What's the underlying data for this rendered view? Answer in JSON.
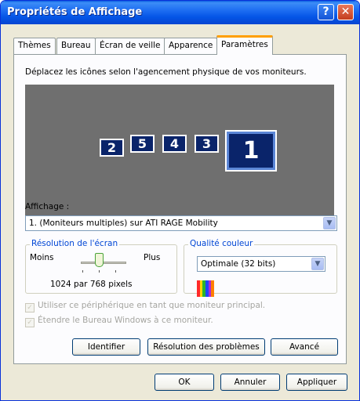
{
  "window": {
    "title": "Propriétés de Affichage",
    "help_glyph": "?",
    "close_glyph": "✕"
  },
  "tabs": [
    {
      "label": "Thèmes"
    },
    {
      "label": "Bureau"
    },
    {
      "label": "Écran de veille"
    },
    {
      "label": "Apparence"
    },
    {
      "label": "Paramètres",
      "active": true
    }
  ],
  "instructions": "Déplacez les icônes selon l'agencement physique de vos moniteurs.",
  "monitors": [
    {
      "number": "2"
    },
    {
      "number": "5"
    },
    {
      "number": "4"
    },
    {
      "number": "3"
    },
    {
      "number": "1",
      "selected": true
    }
  ],
  "display": {
    "label": "Affichage :",
    "value": "1. (Moniteurs multiples) sur ATI RAGE Mobility"
  },
  "resolution": {
    "title": "Résolution de l'écran",
    "min_label": "Moins",
    "max_label": "Plus",
    "value_text": "1024 par 768 pixels"
  },
  "color_quality": {
    "title": "Qualité couleur",
    "value": "Optimale (32 bits)",
    "swatch_colors": [
      "#ff2a2a",
      "#ffd700",
      "#2bb52b",
      "#1e46ff",
      "#b12bd1",
      "#ff7f00"
    ]
  },
  "options": {
    "primary": "Utiliser ce périphérique en tant que moniteur principal.",
    "extend": "Étendre le Bureau Windows à ce moniteur.",
    "check_glyph": "✓"
  },
  "panel_buttons": {
    "identify": "Identifier",
    "troubleshoot": "Résolution des problèmes",
    "advanced": "Avancé"
  },
  "footer_buttons": {
    "ok": "OK",
    "cancel": "Annuler",
    "apply": "Appliquer"
  },
  "dropdown_glyph": "▼"
}
